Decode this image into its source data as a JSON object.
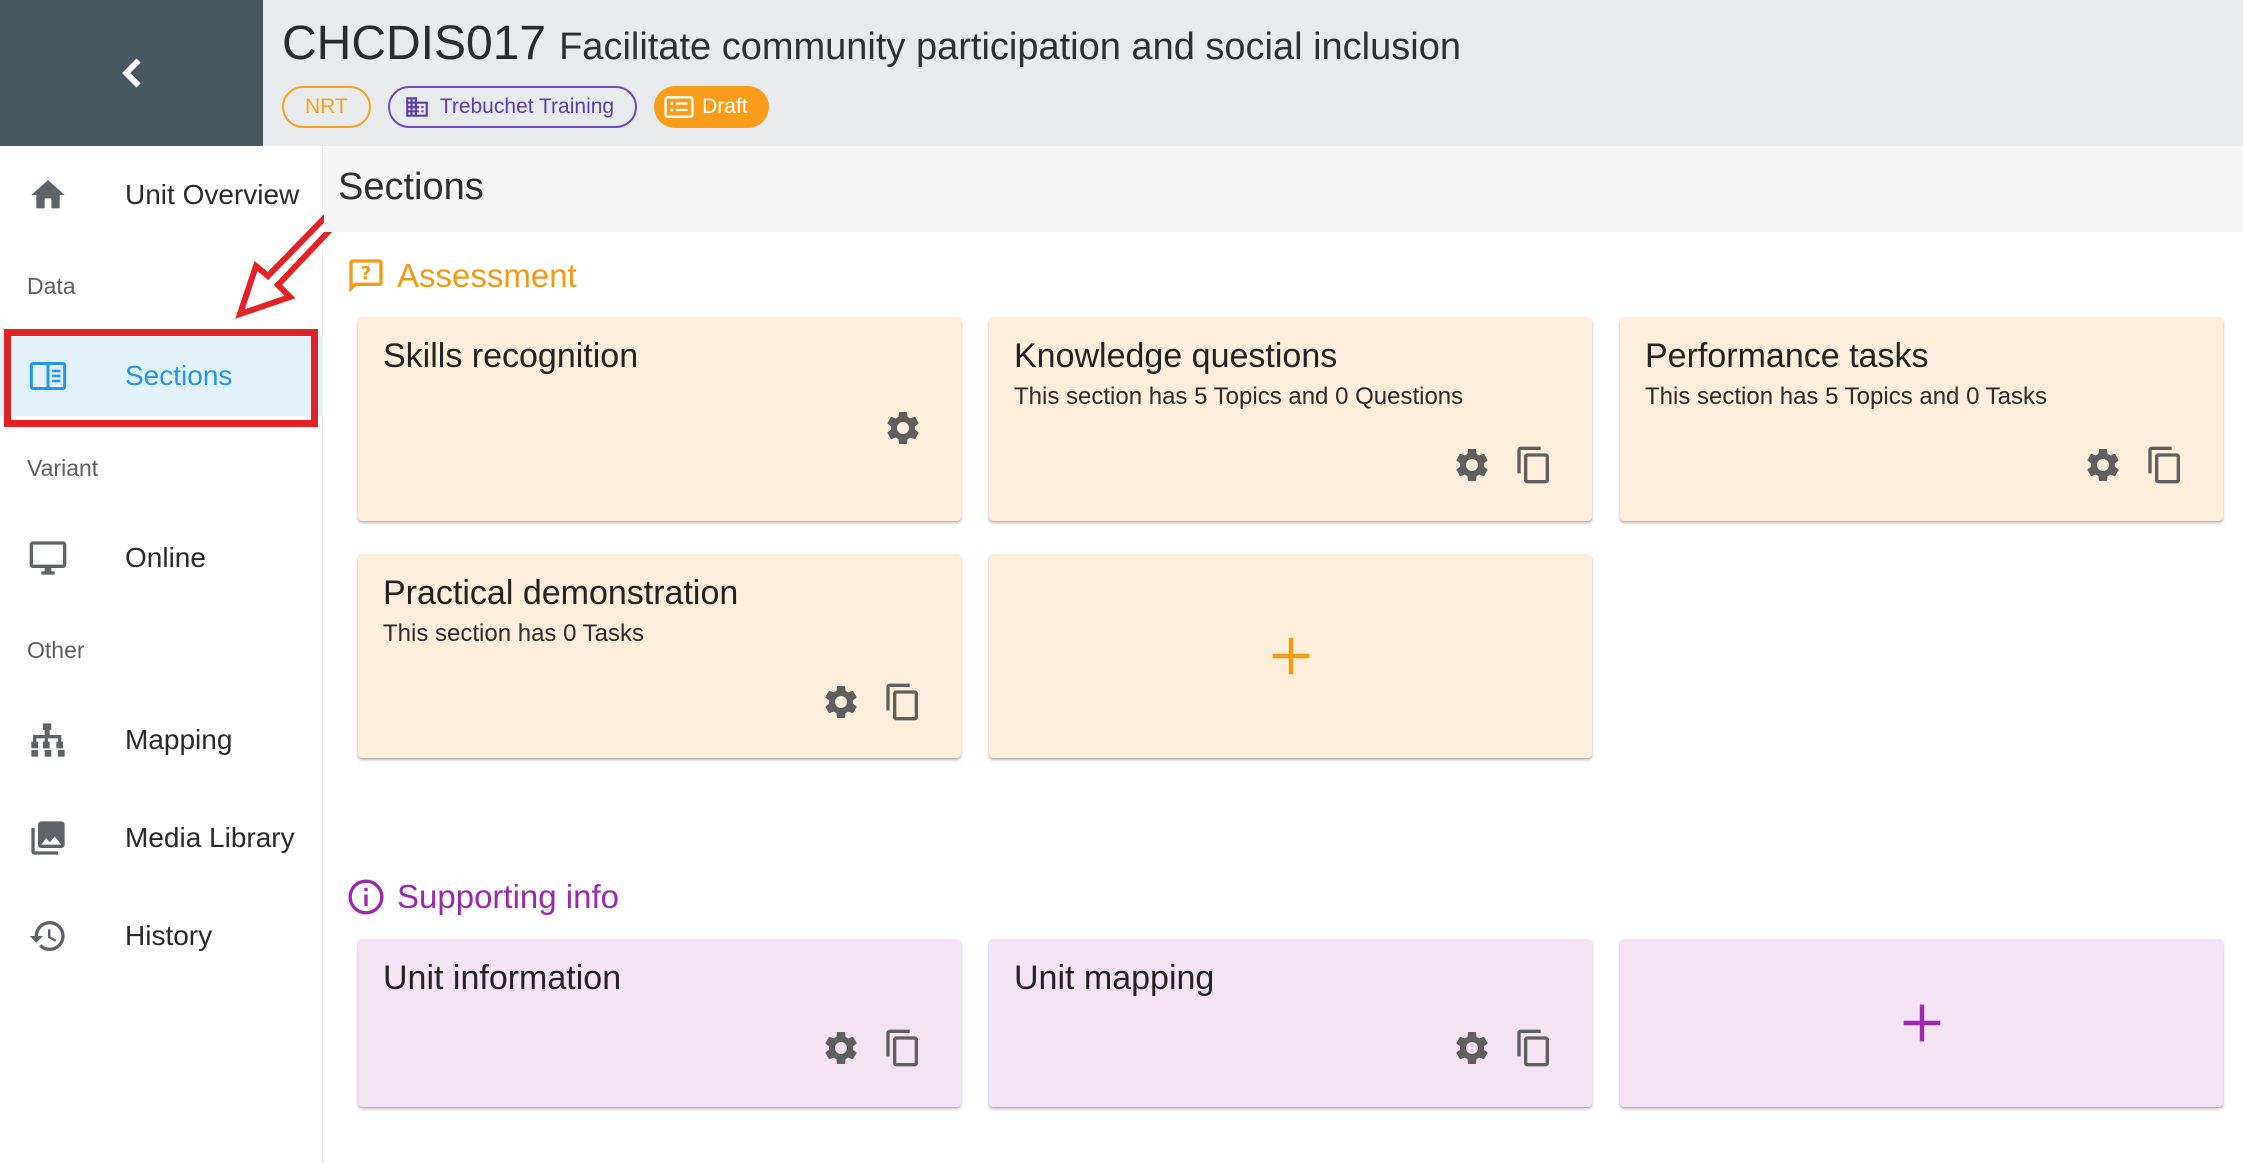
{
  "header": {
    "unit_code": "CHCDIS017",
    "unit_name": "Facilitate community participation and social inclusion",
    "chips": {
      "nrt": "NRT",
      "org": "Trebuchet Training",
      "status": "Draft"
    }
  },
  "sidebar": {
    "overview": "Unit Overview",
    "group_data": "Data",
    "sections": "Sections",
    "group_variant": "Variant",
    "online": "Online",
    "group_other": "Other",
    "mapping": "Mapping",
    "media_library": "Media Library",
    "history": "History"
  },
  "main": {
    "title": "Sections",
    "assessment": {
      "heading": "Assessment",
      "cards": [
        {
          "title": "Skills recognition",
          "subtitle": ""
        },
        {
          "title": "Knowledge questions",
          "subtitle": "This section has 5 Topics and 0 Questions"
        },
        {
          "title": "Performance tasks",
          "subtitle": "This section has 5 Topics and 0 Tasks"
        },
        {
          "title": "Practical demonstration",
          "subtitle": "This section has 0 Tasks"
        }
      ]
    },
    "supporting": {
      "heading": "Supporting info",
      "cards": [
        {
          "title": "Unit information"
        },
        {
          "title": "Unit mapping"
        }
      ]
    }
  },
  "colors": {
    "accent_orange": "#f39a12",
    "accent_purple": "#9c27b0",
    "active_blue": "#2196f3",
    "annotation_red": "#e32228",
    "header_dark": "#475861"
  }
}
